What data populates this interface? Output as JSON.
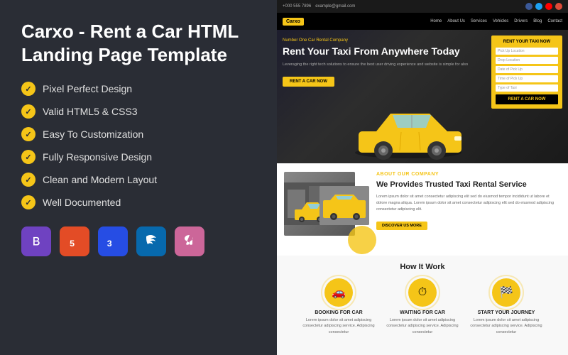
{
  "left": {
    "title": "Carxo - Rent a Car HTML Landing Page Template",
    "features": [
      "Pixel Perfect Design",
      "Valid HTML5 & CSS3",
      "Easy To Customization",
      "Fully Responsive Design",
      "Clean and Modern Layout",
      "Well Documented"
    ],
    "tech_badges": [
      {
        "label": "B",
        "type": "bootstrap",
        "title": "Bootstrap"
      },
      {
        "label": "5",
        "type": "html5",
        "title": "HTML5"
      },
      {
        "label": "3",
        "type": "css3",
        "title": "CSS3"
      },
      {
        "label": "◎",
        "type": "jquery",
        "title": "jQuery"
      },
      {
        "label": "S",
        "type": "sass",
        "title": "Sass"
      }
    ]
  },
  "preview": {
    "topbar": {
      "phone": "+000 555 7896",
      "email": "example@gmail.com"
    },
    "nav": {
      "logo": "Carxo",
      "links": [
        "Home",
        "About Us",
        "Services",
        "Vehicles",
        "Drivers",
        "Blog",
        "Contact"
      ]
    },
    "hero": {
      "small_text": "Number One Car Rental Company",
      "title": "Rent Your Taxi From Anywhere Today",
      "sub": "Leveraging the right tech solutions to ensure the best user driving experience and website is simple for also",
      "cta": "RENT A CAR NOW"
    },
    "form": {
      "title": "RENT YOUR TAXI NOW",
      "fields": [
        "Pick Up Location",
        "Drop Location",
        "Date of Pick Up",
        "Time of Pick Up",
        "Type of Taxi"
      ],
      "submit": "RENT A CAR NOW"
    },
    "about": {
      "label": "ABOUT OUR COMPANY",
      "title": "We Provides Trusted Taxi Rental Service",
      "desc": "Lorem ipsum dolor sit amet consectetur adipiscing elit sed do eiusmod tempor incididunt ut labore et dolore magna aliqua. Lorem ipsum dolor sit amet consectetur adipiscing elit sed do eiusmod adipiscing consectetur adipiscing elit.",
      "cta": "DISCOVER US MORE"
    },
    "how": {
      "title": "How It Work",
      "steps": [
        {
          "icon": "🚗",
          "title": "BOOKING FOR CAR",
          "desc": "Lorem ipsum dolor sit amet adipiscing consectetur adipiscing service. Adipiscing consectetur"
        },
        {
          "icon": "⏱",
          "title": "WAITING FOR CAR",
          "desc": "Lorem ipsum dolor sit amet adipiscing consectetur adipiscing service. Adipiscing consectetur"
        },
        {
          "icon": "🏁",
          "title": "START YOUR JOURNEY",
          "desc": "Lorem ipsum dolor sit amet adipiscing consectetur adipiscing service. Adipiscing consectetur"
        }
      ]
    }
  }
}
